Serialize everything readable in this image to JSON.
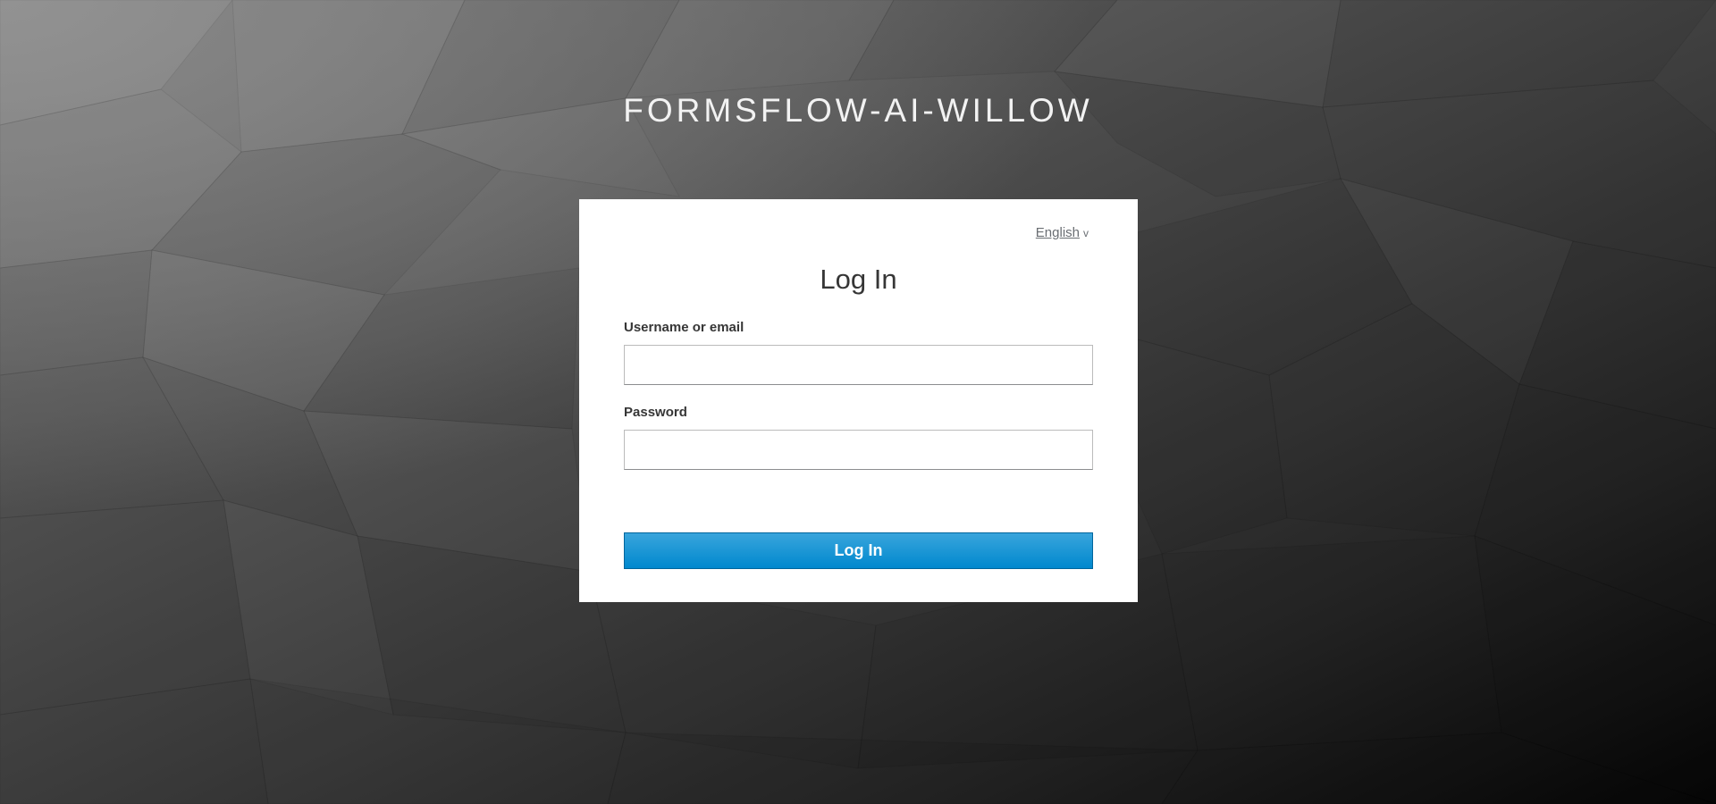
{
  "header": {
    "realm_title": "FORMSFLOW-AI-WILLOW"
  },
  "login_card": {
    "locale": {
      "selected": "English",
      "icon": "chevron-down-icon"
    },
    "title": "Log In",
    "username": {
      "label": "Username or email",
      "value": "",
      "placeholder": ""
    },
    "password": {
      "label": "Password",
      "value": "",
      "placeholder": ""
    },
    "submit_label": "Log In"
  },
  "colors": {
    "button_primary": "#0088ce",
    "button_primary_light": "#39a5dc",
    "card_background": "#ffffff",
    "title_text": "#f2f2f2"
  }
}
